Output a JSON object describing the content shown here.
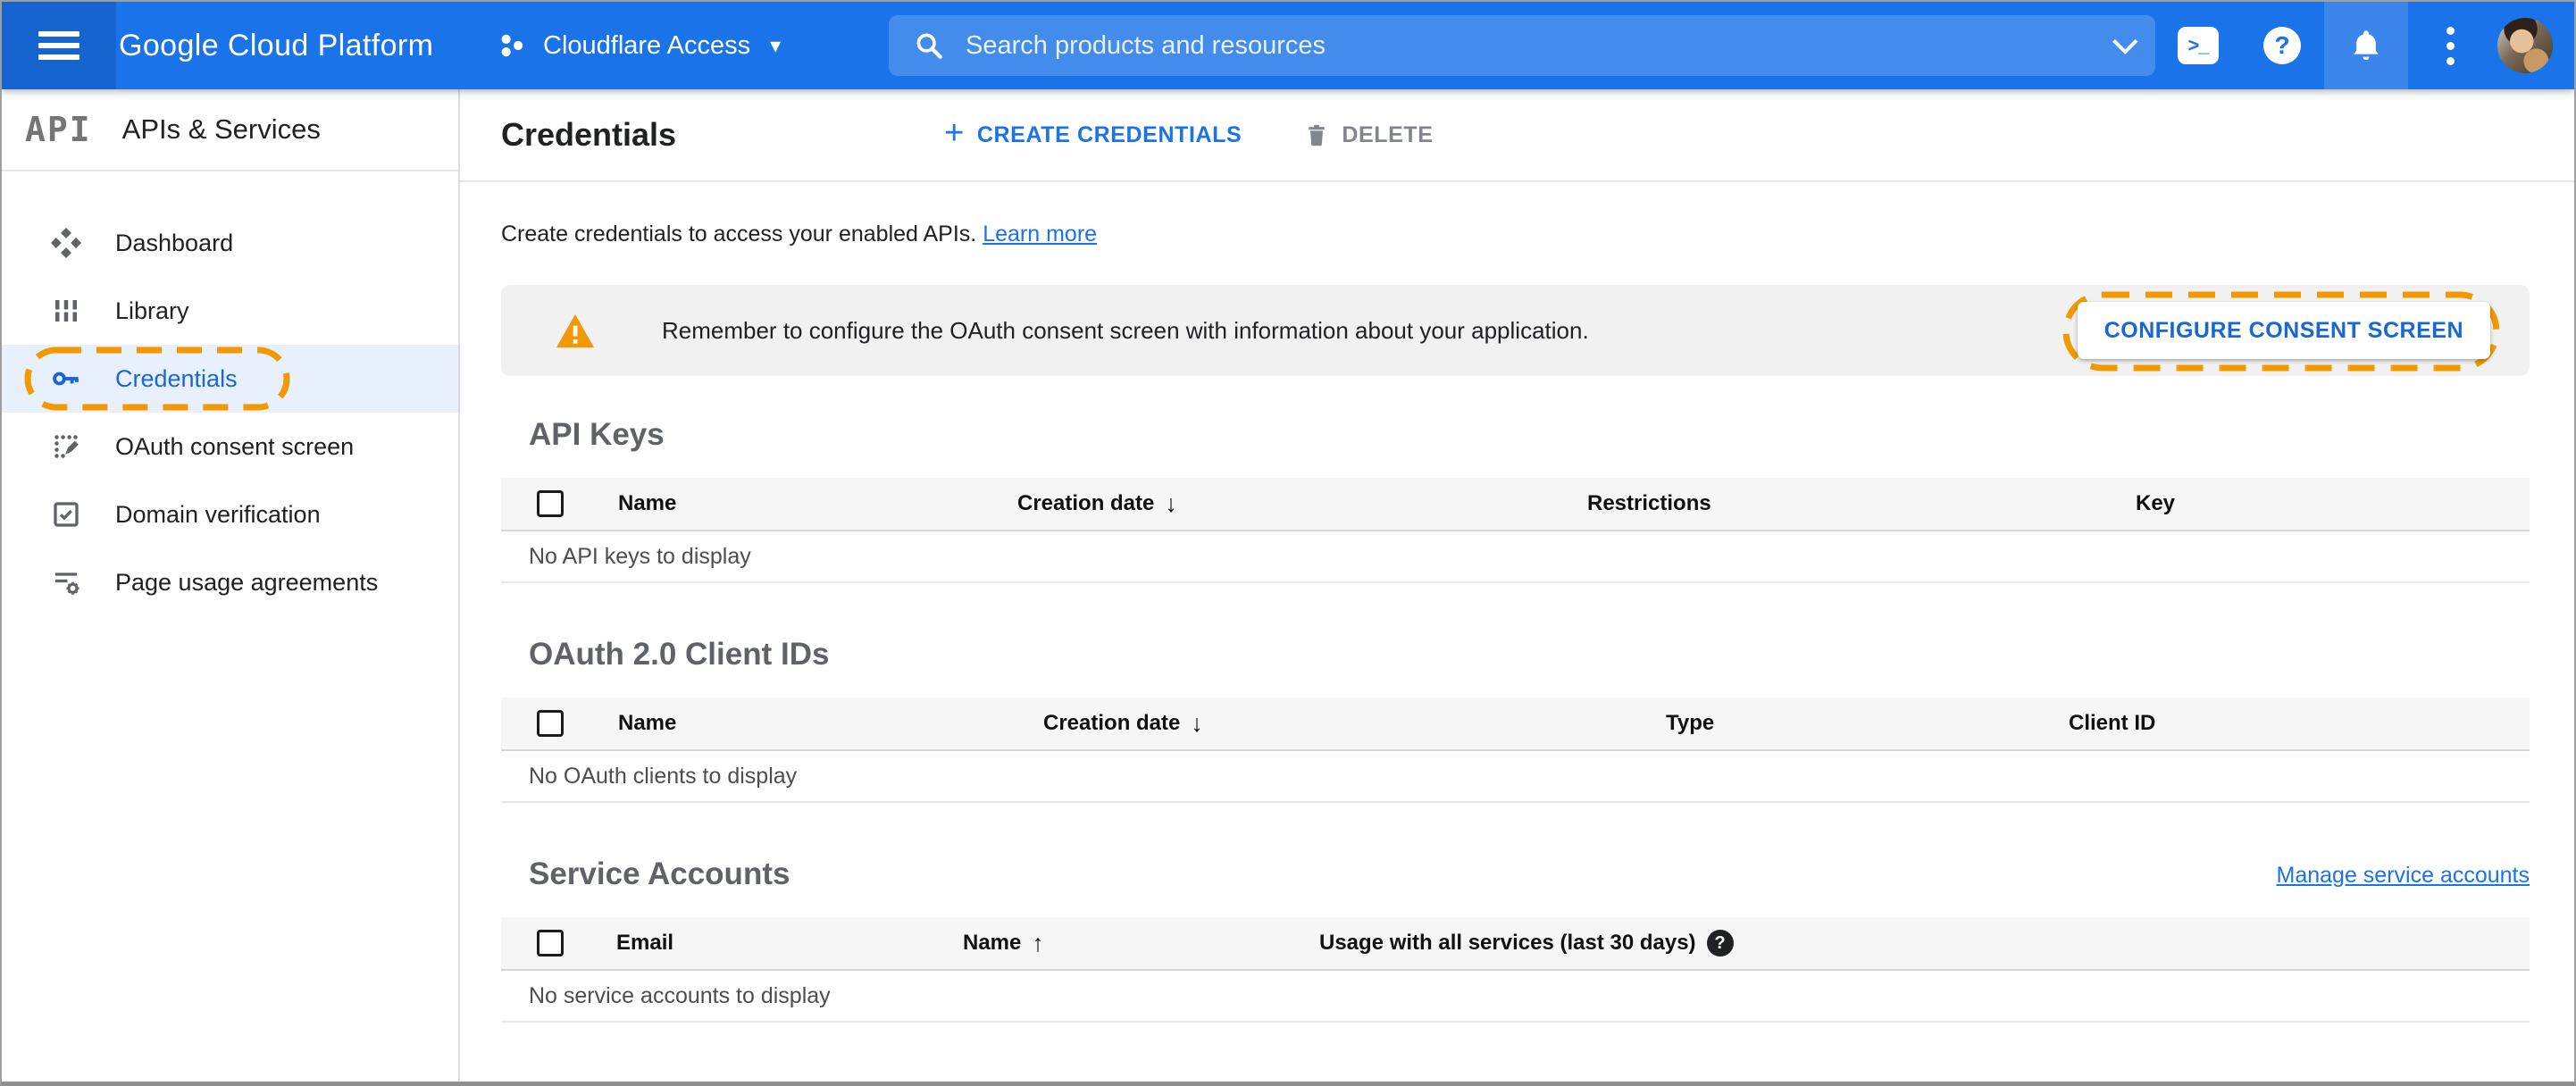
{
  "colors": {
    "appbar_blue": "#1a73e8",
    "appbar_dark_blue": "#1564d0",
    "active_item_blue": "#1967d2",
    "active_item_bg": "#e8f0fe",
    "link_blue": "#1a73e8",
    "annotation_orange": "#f29900",
    "warning_orange": "#f29900",
    "banner_bg": "#f1f1f1",
    "table_header_bg": "#f6f6f6"
  },
  "glyphs": {
    "caret_down": "▾",
    "cloud_shell": ">_",
    "help": "?",
    "plus": "+",
    "sort_desc": "↓",
    "sort_asc": "↑",
    "help_badge": "?"
  },
  "appbar": {
    "product_name": "Google Cloud Platform",
    "project": {
      "name": "Cloudflare Access"
    },
    "search": {
      "placeholder": "Search products and resources"
    }
  },
  "sidebar": {
    "logo": "API",
    "title": "APIs & Services",
    "items": [
      {
        "label": "Dashboard",
        "active": false
      },
      {
        "label": "Library",
        "active": false
      },
      {
        "label": "Credentials",
        "active": true,
        "annotated": true
      },
      {
        "label": "OAuth consent screen",
        "active": false
      },
      {
        "label": "Domain verification",
        "active": false
      },
      {
        "label": "Page usage agreements",
        "active": false
      }
    ]
  },
  "main": {
    "toolbar": {
      "title": "Credentials",
      "create_label": "CREATE CREDENTIALS",
      "delete_label": "DELETE"
    },
    "intro": {
      "text": "Create credentials to access your enabled APIs.",
      "link": "Learn more"
    },
    "banner": {
      "message": "Remember to configure the OAuth consent screen with information about your application.",
      "button": "CONFIGURE CONSENT SCREEN"
    },
    "api_keys": {
      "title": "API Keys",
      "columns": [
        "Name",
        "Creation date",
        "Restrictions",
        "Key"
      ],
      "sorted_by": "Creation date",
      "sort_direction": "desc",
      "rows": [],
      "empty_text": "No API keys to display"
    },
    "oauth_clients": {
      "title": "OAuth 2.0 Client IDs",
      "columns": [
        "Name",
        "Creation date",
        "Type",
        "Client ID"
      ],
      "sorted_by": "Creation date",
      "sort_direction": "desc",
      "rows": [],
      "empty_text": "No OAuth clients to display"
    },
    "service_accounts": {
      "title": "Service Accounts",
      "manage_link": "Manage service accounts",
      "columns": [
        "Email",
        "Name",
        "Usage with all services (last 30 days)"
      ],
      "sorted_by": "Name",
      "sort_direction": "asc",
      "rows": [],
      "empty_text": "No service accounts to display"
    }
  }
}
